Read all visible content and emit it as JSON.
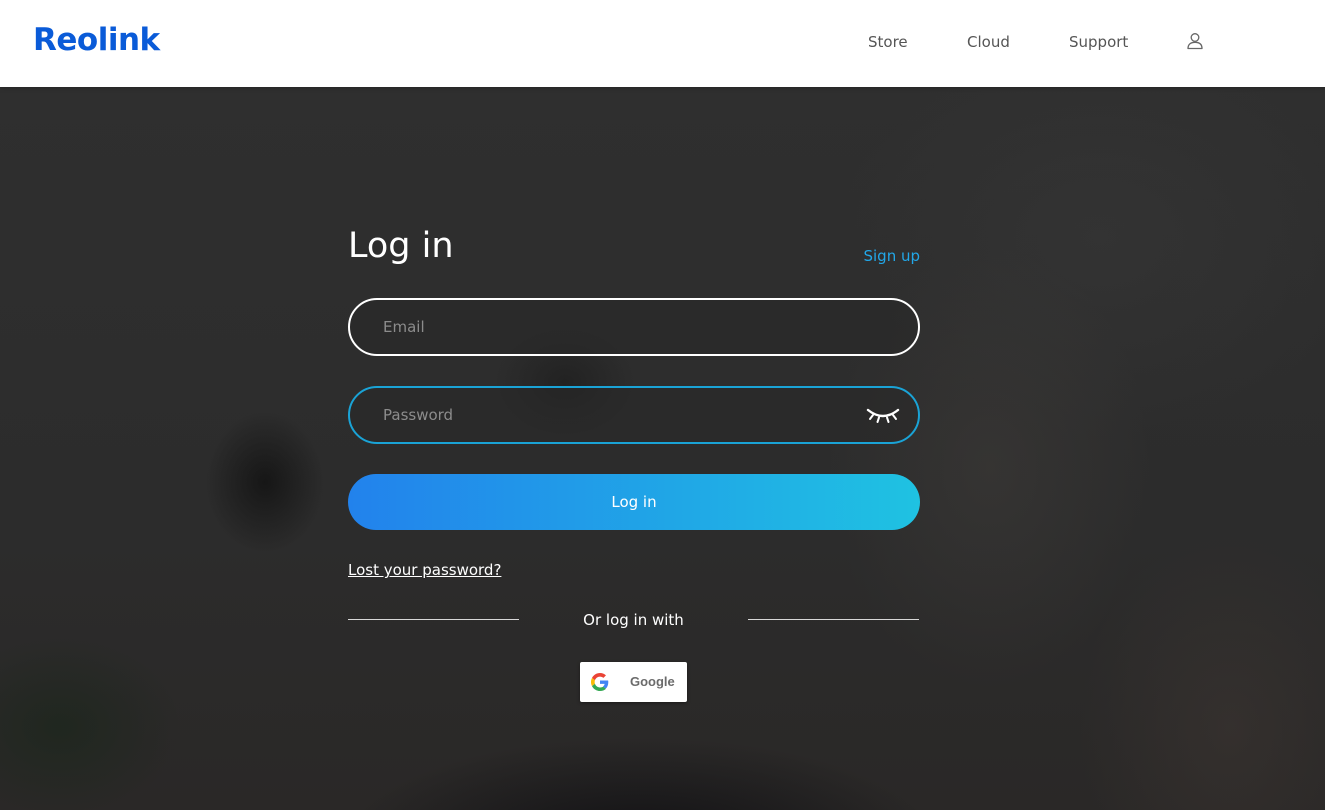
{
  "header": {
    "logo_text": "Reolink",
    "nav": [
      {
        "label": "Store"
      },
      {
        "label": "Cloud"
      },
      {
        "label": "Support"
      }
    ],
    "user_icon": "user-icon"
  },
  "login": {
    "title": "Log in",
    "signup_link": "Sign up",
    "email_placeholder": "Email",
    "email_value": "",
    "password_placeholder": "Password",
    "password_value": "",
    "password_toggle_icon": "eye-closed-icon",
    "submit_label": "Log in",
    "lost_password_link": "Lost your password?",
    "or_text": "Or log in with",
    "google_label": "Google"
  },
  "colors": {
    "brand": "#0a5bd8",
    "accent": "#22a7e8",
    "button_gradient_start": "#2282ec",
    "button_gradient_end": "#1fc2e2",
    "password_border": "#1aa3d6"
  }
}
